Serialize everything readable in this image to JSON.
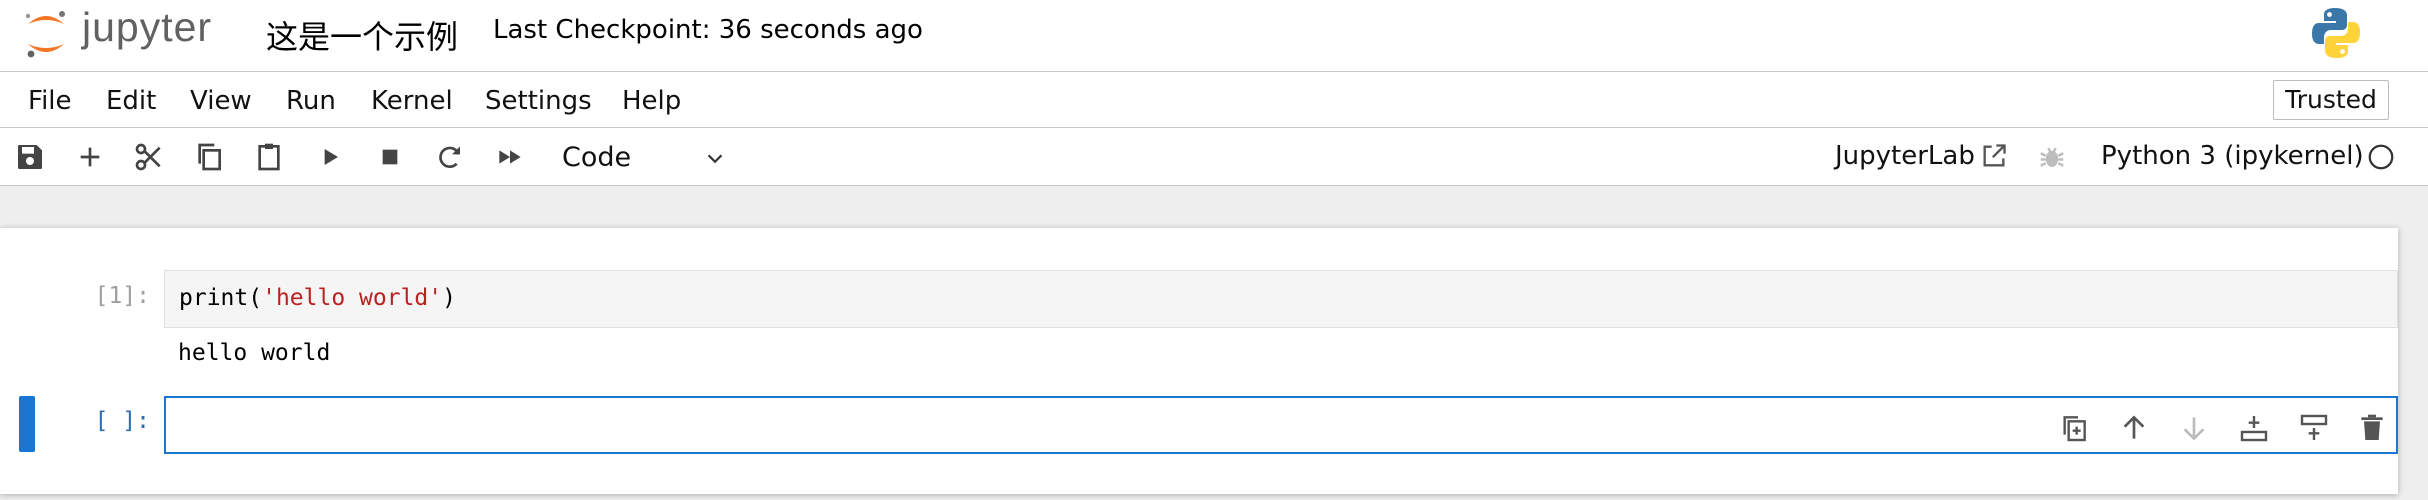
{
  "header": {
    "logo_text": "jupyter",
    "notebook_title": "这是一个示例",
    "checkpoint": "Last Checkpoint: 36 seconds ago",
    "kernel_logo_icon": "python-logo-icon"
  },
  "menubar": {
    "items": [
      "File",
      "Edit",
      "View",
      "Run",
      "Kernel",
      "Settings",
      "Help"
    ],
    "trusted_label": "Trusted"
  },
  "toolbar": {
    "icons": [
      "save-icon",
      "add-cell-icon",
      "cut-icon",
      "copy-icon",
      "paste-icon",
      "run-icon",
      "stop-icon",
      "restart-icon",
      "fast-forward-icon"
    ],
    "cell_type": "Code",
    "jupyterlab_label": "JupyterLab",
    "kernel_name": "Python 3 (ipykernel)",
    "kernel_status": "idle"
  },
  "cells": [
    {
      "prompt": "[1]:",
      "code_func": "print(",
      "code_string": "'hello world'",
      "code_close": ")",
      "output": "hello world"
    },
    {
      "prompt": "[ ]:",
      "code": ""
    }
  ],
  "cell_toolbar": {
    "icons": [
      "duplicate-cell-icon",
      "move-up-icon",
      "move-down-icon",
      "insert-above-icon",
      "insert-below-icon",
      "delete-cell-icon"
    ]
  },
  "colors": {
    "accent": "#1976d2",
    "jupyter_orange": "#f37726",
    "string": "#ba2121",
    "prompt_inactive": "#9e9e9e",
    "prompt_active": "#2a6fb8"
  }
}
